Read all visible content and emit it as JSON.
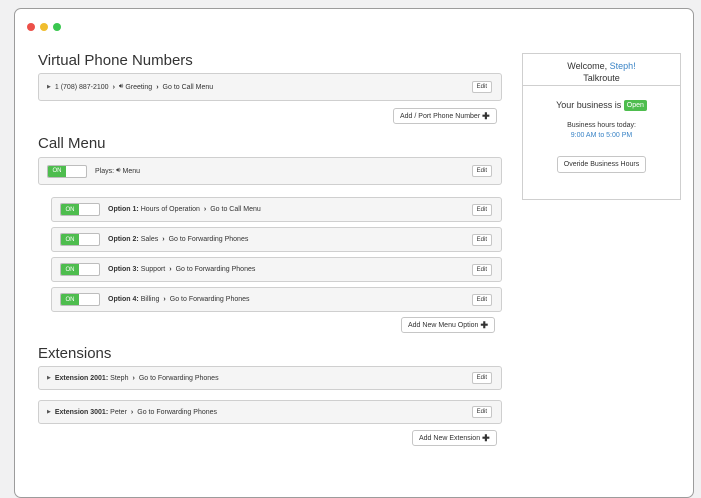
{
  "sections": {
    "numbers_title": "Virtual Phone Numbers",
    "call_menu_title": "Call Menu",
    "extensions_title": "Extensions"
  },
  "phone_number": {
    "number": "1 (708) 887-2100",
    "greeting": "Greeting",
    "action": "Go to Call Menu",
    "edit": "Edit"
  },
  "add_port_button": "Add / Port Phone Number",
  "menu_row": {
    "toggle": "ON",
    "plays_label": "Plays:",
    "plays_value": "Menu",
    "edit": "Edit"
  },
  "options": [
    {
      "toggle": "ON",
      "label": "Option 1:",
      "name": "Hours of Operation",
      "action": "Go to Call Menu",
      "edit": "Edit"
    },
    {
      "toggle": "ON",
      "label": "Option 2:",
      "name": "Sales",
      "action": "Go to Forwarding Phones",
      "edit": "Edit"
    },
    {
      "toggle": "ON",
      "label": "Option 3:",
      "name": "Support",
      "action": "Go to Forwarding Phones",
      "edit": "Edit"
    },
    {
      "toggle": "ON",
      "label": "Option 4:",
      "name": "Billing",
      "action": "Go to Forwarding Phones",
      "edit": "Edit"
    }
  ],
  "add_menu_option_button": "Add New Menu Option",
  "extensions": [
    {
      "label": "Extension 2001:",
      "name": "Steph",
      "action": "Go to Forwarding Phones",
      "edit": "Edit"
    },
    {
      "label": "Extension 3001:",
      "name": "Peter",
      "action": "Go to Forwarding Phones",
      "edit": "Edit"
    }
  ],
  "add_extension_button": "Add New Extension",
  "panel": {
    "welcome": "Welcome,",
    "user": "Steph!",
    "company": "Talkroute",
    "business_is": "Your business is",
    "status": "Open",
    "hours_label": "Business hours today:",
    "hours_value": "9:00 AM to 5:00 PM",
    "override_button": "Overide Business Hours"
  },
  "colors": {
    "accent_green": "#4ebd4e",
    "link_blue": "#3a84c6"
  },
  "icons": {
    "speaker": "speaker-icon",
    "plus": "plus-icon",
    "chevron": "chevron-right-icon",
    "expand": "expand-triangle-icon"
  }
}
